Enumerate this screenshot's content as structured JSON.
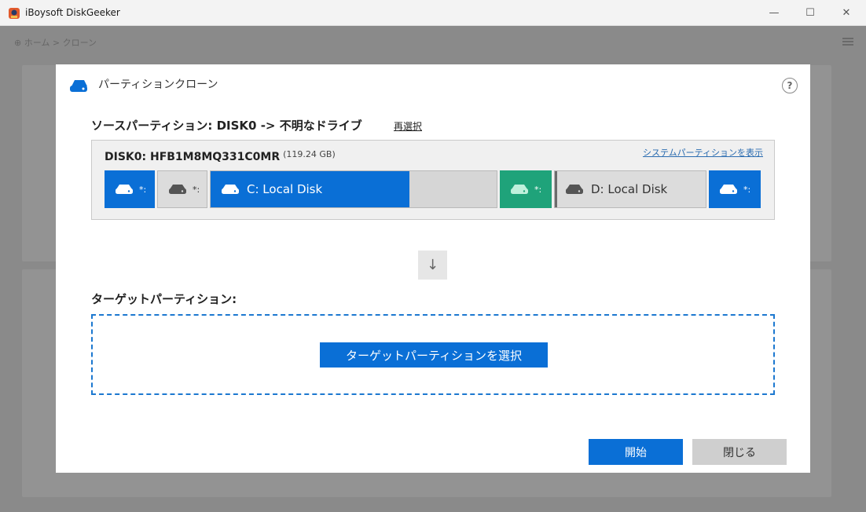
{
  "window": {
    "title": "iBoysoft DiskGeeker",
    "minimize": "—",
    "maximize": "☐",
    "close": "✕"
  },
  "background": {
    "breadcrumb": "⊕ ホーム > クローン"
  },
  "dialog": {
    "title": "パーティションクローン",
    "help": "?",
    "source_heading": "ソースパーティション: DISK0 -> 不明なドライブ",
    "reselect": "再選択",
    "disk": {
      "name": "DISK0: HFB1M8MQ331C0MR",
      "size": "(119.24 GB)",
      "show_system_link": "システムパーティションを表示",
      "partitions": [
        {
          "label": "*:",
          "style": "blue"
        },
        {
          "label": "*:",
          "style": "gray"
        },
        {
          "label": "C: Local Disk",
          "style": "blue",
          "used_fraction": 0.69
        },
        {
          "label": "*:",
          "style": "green"
        },
        {
          "label": "D: Local Disk",
          "style": "gray"
        },
        {
          "label": "*:",
          "style": "blue"
        }
      ]
    },
    "arrow": "↓",
    "target_heading": "ターゲットパーティション:",
    "select_target_button": "ターゲットパーティションを選択",
    "start_button": "開始",
    "close_button": "閉じる"
  },
  "colors": {
    "accent": "#0a6fd6",
    "green": "#1fa37a",
    "gray": "#dcdcdc"
  }
}
